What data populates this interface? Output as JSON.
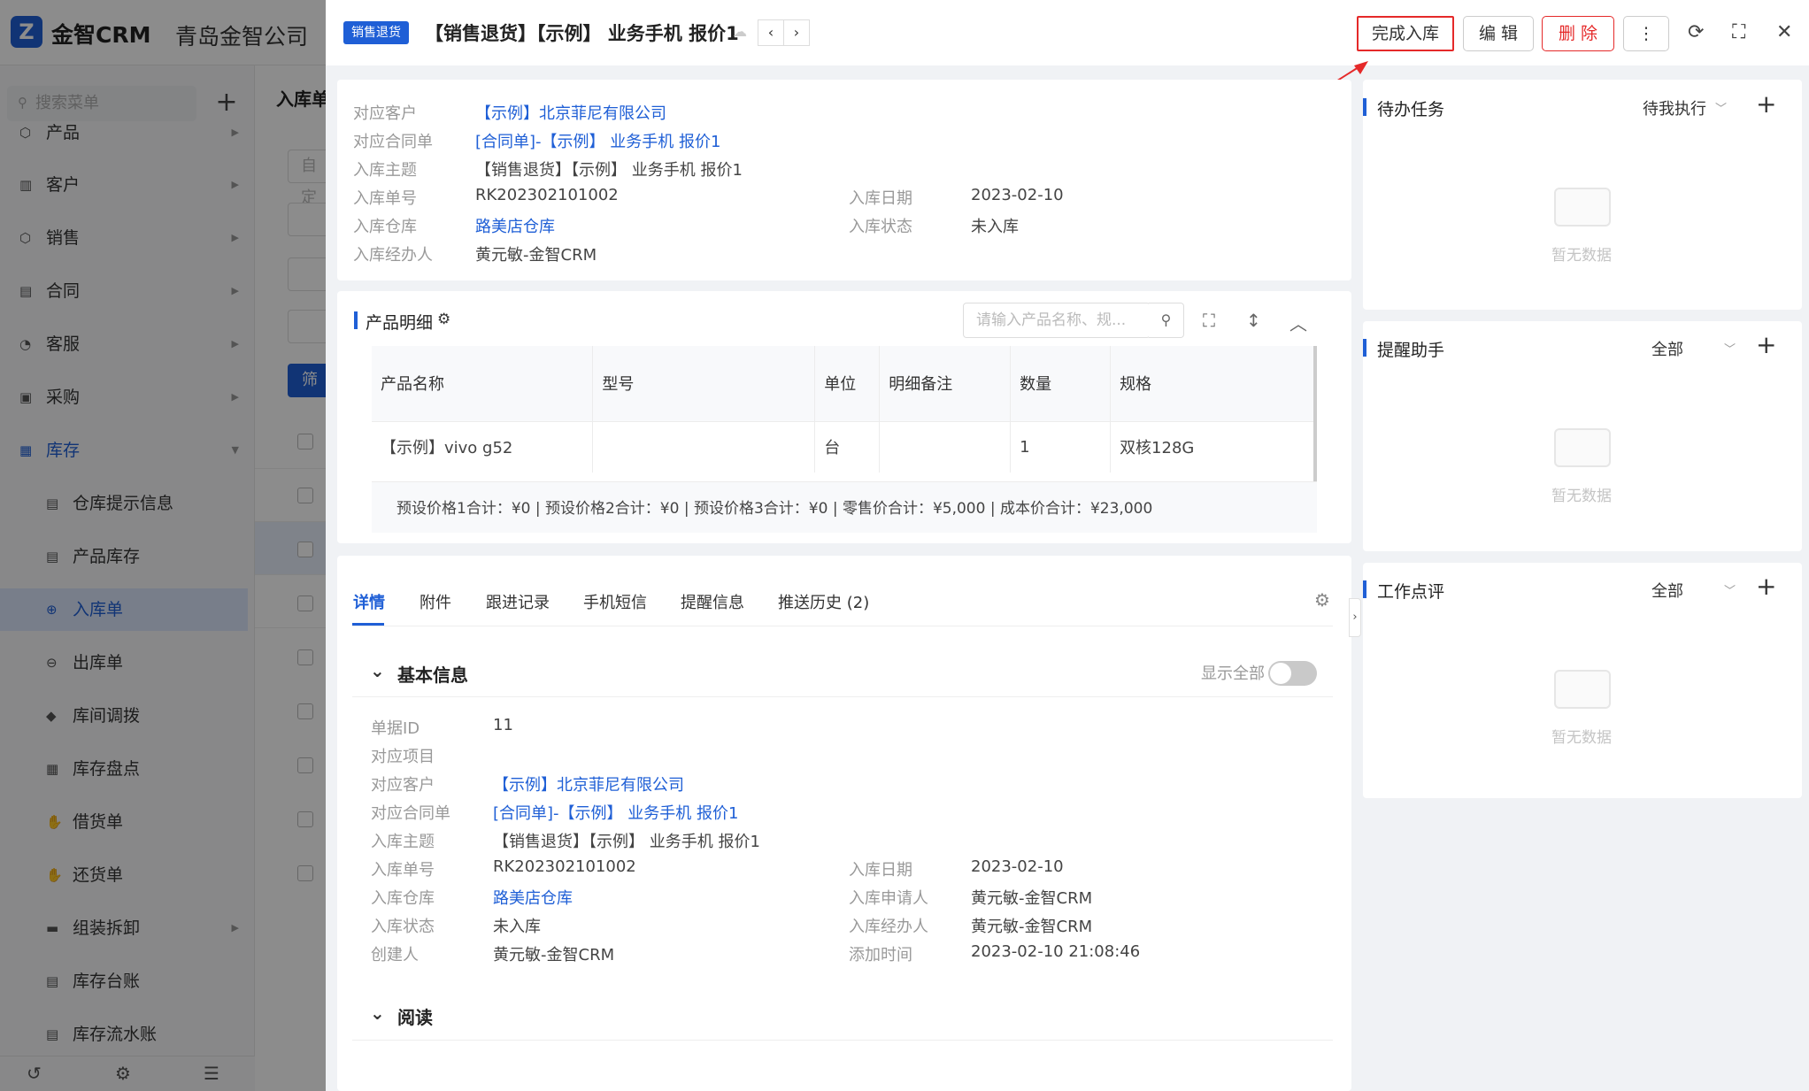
{
  "app": {
    "brand": "金智CRM",
    "company": "青岛金智公司"
  },
  "sidebar": {
    "search_placeholder": "搜索菜单",
    "items": [
      {
        "label": "产品"
      },
      {
        "label": "客户"
      },
      {
        "label": "销售"
      },
      {
        "label": "合同"
      },
      {
        "label": "客服"
      },
      {
        "label": "采购"
      },
      {
        "label": "库存"
      }
    ],
    "sub_items": [
      {
        "label": "仓库提示信息"
      },
      {
        "label": "产品库存"
      },
      {
        "label": "入库单"
      },
      {
        "label": "出库单"
      },
      {
        "label": "库间调拨"
      },
      {
        "label": "库存盘点"
      },
      {
        "label": "借货单"
      },
      {
        "label": "还货单"
      },
      {
        "label": "组装拆卸"
      },
      {
        "label": "库存台账"
      },
      {
        "label": "库存流水账"
      }
    ]
  },
  "background": {
    "tab_label": "入库单",
    "box1": "自定",
    "filter_label": "筛"
  },
  "drawer": {
    "badge": "销售退货",
    "title": "【销售退货】【示例】 业务手机 报价1",
    "buttons": {
      "complete": "完成入库",
      "edit": "编 辑",
      "delete": "删 除",
      "more": "⋮"
    },
    "summary": {
      "customer_label": "对应客户",
      "customer": "【示例】北京菲尼有限公司",
      "contract_label": "对应合同单",
      "contract": "[合同单]-【示例】 业务手机 报价1",
      "subject_label": "入库主题",
      "subject": "【销售退货】【示例】 业务手机 报价1",
      "number_label": "入库单号",
      "number": "RK202302101002",
      "date_label": "入库日期",
      "date": "2023-02-10",
      "warehouse_label": "入库仓库",
      "warehouse": "路美店仓库",
      "status_label": "入库状态",
      "status": "未入库",
      "handler_label": "入库经办人",
      "handler": "黄元敏-金智CRM"
    },
    "products": {
      "title": "产品明细",
      "search_placeholder": "请输入产品名称、规...",
      "columns": [
        "产品名称",
        "型号",
        "单位",
        "明细备注",
        "数量",
        "规格"
      ],
      "rows": [
        [
          "【示例】vivo g52",
          "",
          "台",
          "",
          "1",
          "双核128G"
        ]
      ],
      "totals": "预设价格1合计：¥0 |  预设价格2合计：¥0 |  预设价格3合计：¥0 |  零售价合计：¥5,000 |  成本价合计：¥23,000"
    },
    "tabs": [
      "详情",
      "附件",
      "跟进记录",
      "手机短信",
      "提醒信息",
      "推送历史 (2)"
    ],
    "basic": {
      "title": "基本信息",
      "show_all": "显示全部",
      "id_label": "单据ID",
      "id": "11",
      "project_label": "对应项目",
      "project": "",
      "customer_label": "对应客户",
      "customer": "【示例】北京菲尼有限公司",
      "contract_label": "对应合同单",
      "contract": "[合同单]-【示例】 业务手机 报价1",
      "subject_label": "入库主题",
      "subject": "【销售退货】【示例】 业务手机 报价1",
      "number_label": "入库单号",
      "number": "RK202302101002",
      "date_label": "入库日期",
      "date": "2023-02-10",
      "warehouse_label": "入库仓库",
      "warehouse": "路美店仓库",
      "applicant_label": "入库申请人",
      "applicant": "黄元敏-金智CRM",
      "status_label": "入库状态",
      "status": "未入库",
      "handler_label": "入库经办人",
      "handler": "黄元敏-金智CRM",
      "creator_label": "创建人",
      "creator": "黄元敏-金智CRM",
      "created_label": "添加时间",
      "created": "2023-02-10 21:08:46"
    },
    "read_title": "阅读"
  },
  "right_panels": [
    {
      "title": "待办任务",
      "filter": "待我执行",
      "empty": "暂无数据"
    },
    {
      "title": "提醒助手",
      "filter": "全部",
      "empty": "暂无数据"
    },
    {
      "title": "工作点评",
      "filter": "全部",
      "empty": "暂无数据"
    }
  ],
  "colors": {
    "primary": "#1f5fd6",
    "danger": "#e52929",
    "annotation_arrow": "#e52929"
  }
}
